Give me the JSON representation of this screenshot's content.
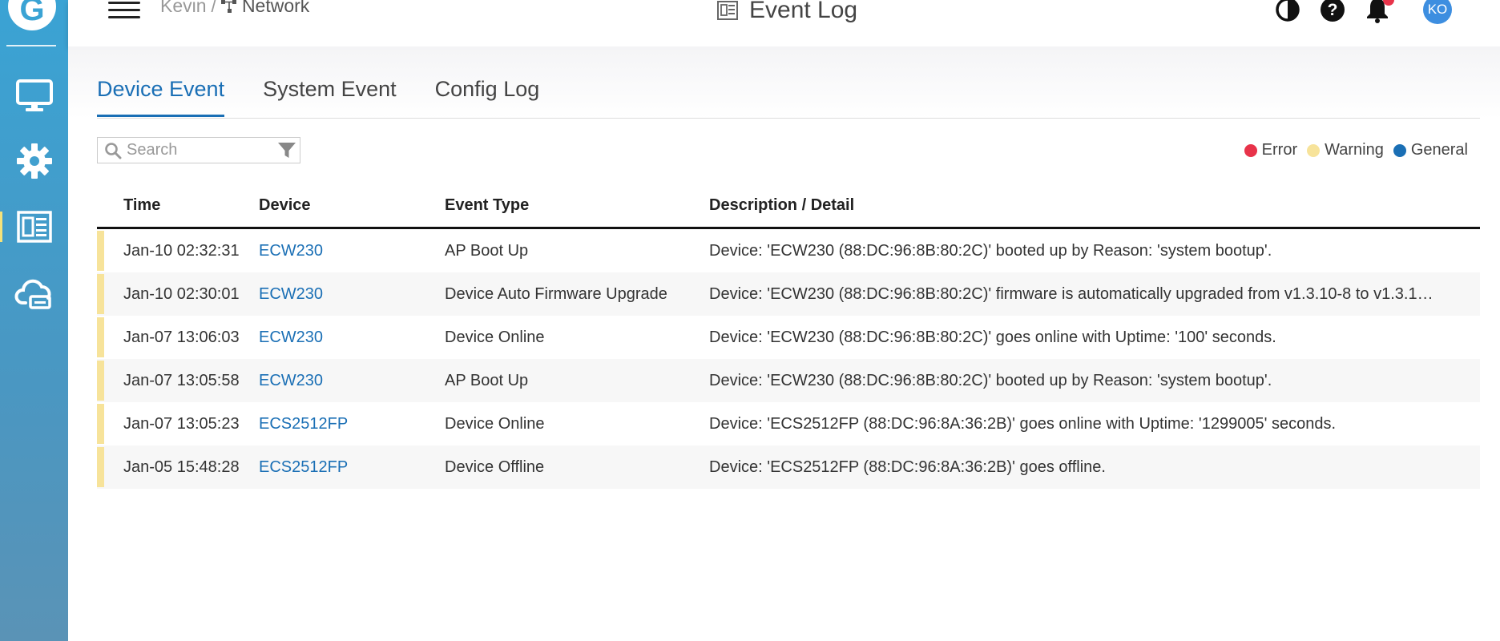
{
  "brand": {
    "logo_letter": "G"
  },
  "colors": {
    "accent": "#1a6fb5",
    "sidebar": "#3aa3d4",
    "error": "#e8334a",
    "warning": "#f7e39a",
    "general": "#1a6fb5"
  },
  "sidebar": {
    "items": [
      {
        "name": "monitor-icon"
      },
      {
        "name": "gear-icon"
      },
      {
        "name": "event-log-icon",
        "active": true
      },
      {
        "name": "cloud-device-icon"
      }
    ]
  },
  "header": {
    "breadcrumb_parent": "Kevin",
    "breadcrumb_separator": "/",
    "breadcrumb_current": "Network",
    "title": "Event Log",
    "avatar_initials": "KO"
  },
  "tabs": [
    {
      "label": "Device Event",
      "active": true
    },
    {
      "label": "System Event"
    },
    {
      "label": "Config Log"
    }
  ],
  "search": {
    "placeholder": "Search",
    "value": ""
  },
  "legend": [
    {
      "label": "Error",
      "color": "#e8334a"
    },
    {
      "label": "Warning",
      "color": "#f7e39a"
    },
    {
      "label": "General",
      "color": "#1a6fb5"
    }
  ],
  "table": {
    "headers": {
      "time": "Time",
      "device": "Device",
      "event_type": "Event Type",
      "description": "Description / Detail"
    },
    "rows": [
      {
        "time": "Jan-10 02:32:31",
        "device": "ECW230",
        "event_type": "AP Boot Up",
        "description": "Device: 'ECW230 (88:DC:96:8B:80:2C)' booted up by Reason: 'system bootup'.",
        "severity": "warning"
      },
      {
        "time": "Jan-10 02:30:01",
        "device": "ECW230",
        "event_type": "Device Auto Firmware Upgrade",
        "description": "Device: 'ECW230 (88:DC:96:8B:80:2C)' firmware is automatically upgraded from v1.3.10-8 to v1.3.1…",
        "severity": "warning"
      },
      {
        "time": "Jan-07 13:06:03",
        "device": "ECW230",
        "event_type": "Device Online",
        "description": "Device: 'ECW230 (88:DC:96:8B:80:2C)' goes online with Uptime: '100' seconds.",
        "severity": "warning"
      },
      {
        "time": "Jan-07 13:05:58",
        "device": "ECW230",
        "event_type": "AP Boot Up",
        "description": "Device: 'ECW230 (88:DC:96:8B:80:2C)' booted up by Reason: 'system bootup'.",
        "severity": "warning"
      },
      {
        "time": "Jan-07 13:05:23",
        "device": "ECS2512FP",
        "event_type": "Device Online",
        "description": "Device: 'ECS2512FP (88:DC:96:8A:36:2B)' goes online with Uptime: '1299005' seconds.",
        "severity": "warning"
      },
      {
        "time": "Jan-05 15:48:28",
        "device": "ECS2512FP",
        "event_type": "Device Offline",
        "description": "Device: 'ECS2512FP (88:DC:96:8A:36:2B)' goes offline.",
        "severity": "warning"
      }
    ]
  }
}
